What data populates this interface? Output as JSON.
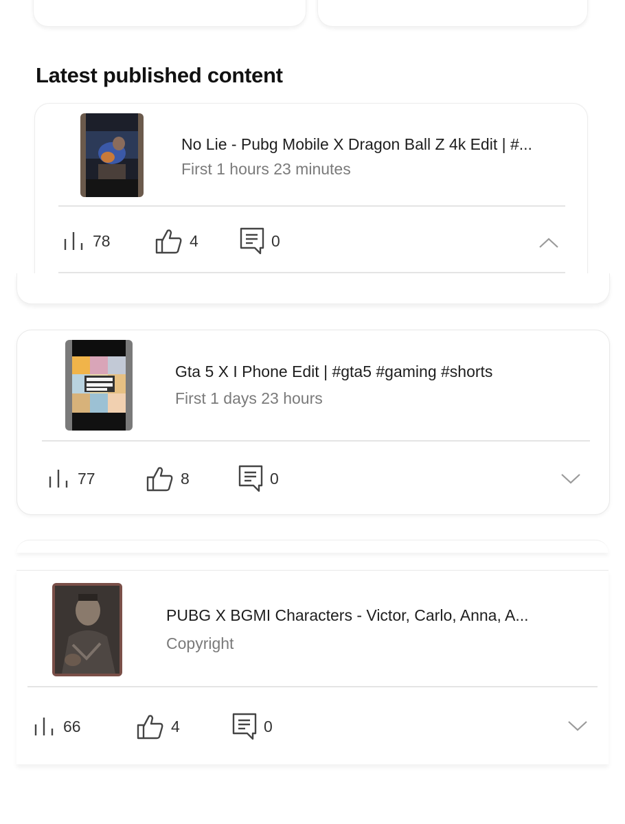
{
  "section": {
    "title": "Latest published content"
  },
  "items": [
    {
      "title": "No Lie - Pubg Mobile X Dragon Ball Z 4k Edit  | #...",
      "subtitle": "First 1 hours 23 minutes",
      "views": "78",
      "likes": "4",
      "comments": "0",
      "expanded": true
    },
    {
      "title": "Gta 5 X I Phone Edit | #gta5 #gaming #shorts",
      "subtitle": "First 1 days 23 hours",
      "views": "77",
      "likes": "8",
      "comments": "0",
      "expanded": false
    },
    {
      "title": "PUBG X BGMI Characters - Victor, Carlo, Anna, A...",
      "subtitle": "Copyright",
      "views": "66",
      "likes": "4",
      "comments": "0",
      "expanded": false
    }
  ],
  "icons": {
    "views": "bar-chart-icon",
    "likes": "thumbs-up-icon",
    "comments": "comment-icon",
    "collapse": "chevron-up-icon",
    "expand": "chevron-down-icon"
  },
  "colors": {
    "text": "#1e1e1e",
    "muted": "#7a7a7a",
    "divider": "#e4e4e4",
    "icon": "#444444"
  }
}
